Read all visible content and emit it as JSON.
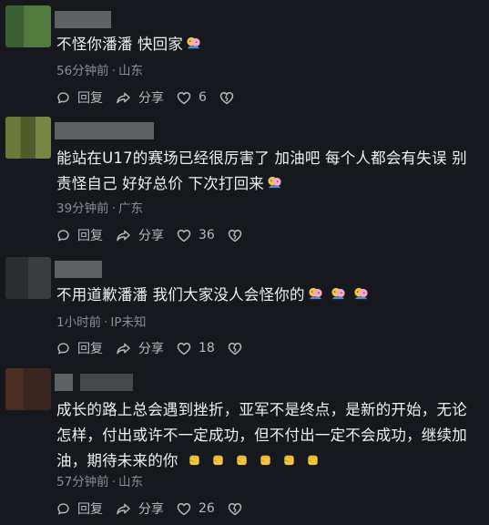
{
  "comments": [
    {
      "text": "不怪你潘潘 快回家",
      "emoji_type": "hug",
      "emoji_count": 1,
      "time": "56分钟前",
      "location": "山东",
      "reply_label": "回复",
      "share_label": "分享",
      "likes": "6"
    },
    {
      "text": "能站在U17的赛场已经很厉害了 加油吧 每个人都会有失误 别责怪自己 好好总价 下次打回来",
      "emoji_type": "hug",
      "emoji_count": 1,
      "time": "39分钟前",
      "location": "广东",
      "reply_label": "回复",
      "share_label": "分享",
      "likes": "36"
    },
    {
      "text": "不用道歉潘潘 我们大家没人会怪你的",
      "emoji_type": "hug",
      "emoji_count": 3,
      "time": "1小时前",
      "location": "IP未知",
      "reply_label": "回复",
      "share_label": "分享",
      "likes": "18"
    },
    {
      "text": "成长的路上总会遇到挫折，亚军不是终点，是新的开始，无论怎样，付出或许不一定成功，但不付出一定不会成功，继续加油，期待未来的你",
      "emoji_type": "fist",
      "emoji_count": 6,
      "time": "57分钟前",
      "location": "山东",
      "reply_label": "回复",
      "share_label": "分享",
      "likes": "26"
    }
  ],
  "separator": "·",
  "colors": {
    "background": "#16181d",
    "text": "#eef0f2",
    "meta": "#8a8d93",
    "actions": "#b7b9be"
  }
}
